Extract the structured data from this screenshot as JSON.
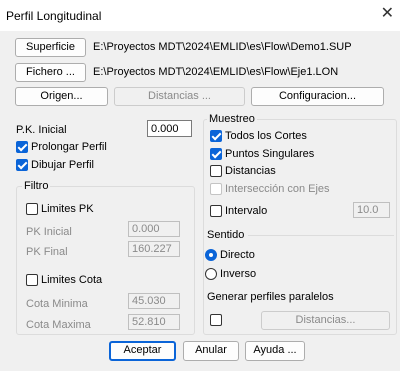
{
  "window": {
    "title": "Perfil Longitudinal",
    "close_glyph": "✕"
  },
  "files": {
    "superficie_label": "Superficie",
    "superficie_path": "E:\\Proyectos MDT\\2024\\EMLID\\es\\Flow\\Demo1.SUP",
    "fichero_label": "Fichero ...",
    "fichero_path": "E:\\Proyectos MDT\\2024\\EMLID\\es\\Flow\\Eje1.LON"
  },
  "toolbar": {
    "origen": "Origen...",
    "distancias": "Distancias ...",
    "configuracion": "Configuracion..."
  },
  "left": {
    "pk_inicial_label": "P.K. Inicial",
    "pk_inicial_value": "0.000",
    "prolongar_perfil": "Prolongar Perfil",
    "dibujar_perfil": "Dibujar Perfil"
  },
  "filtro": {
    "title": "Filtro",
    "limites_pk": "Limites PK",
    "pk_inicial_label": "PK Inicial",
    "pk_inicial_value": "0.000",
    "pk_final_label": "PK Final",
    "pk_final_value": "160.227",
    "limites_cota": "Limites Cota",
    "cota_minima_label": "Cota Minima",
    "cota_minima_value": "45.030",
    "cota_maxima_label": "Cota Maxima",
    "cota_maxima_value": "52.810"
  },
  "muestreo": {
    "title": "Muestreo",
    "todos_los_cortes": "Todos los Cortes",
    "puntos_singulares": "Puntos Singulares",
    "distancias": "Distancias",
    "interseccion": "Intersección con Ejes",
    "intervalo": "Intervalo",
    "intervalo_value": "10.0"
  },
  "sentido": {
    "title": "Sentido",
    "directo": "Directo",
    "inverso": "Inverso"
  },
  "paralelos": {
    "title": "Generar perfiles paralelos",
    "distancias": "Distancias..."
  },
  "footer": {
    "aceptar": "Aceptar",
    "anular": "Anular",
    "ayuda": "Ayuda ..."
  },
  "colors": {
    "accent": "#0a64d8",
    "background": "#f0f0f0"
  }
}
